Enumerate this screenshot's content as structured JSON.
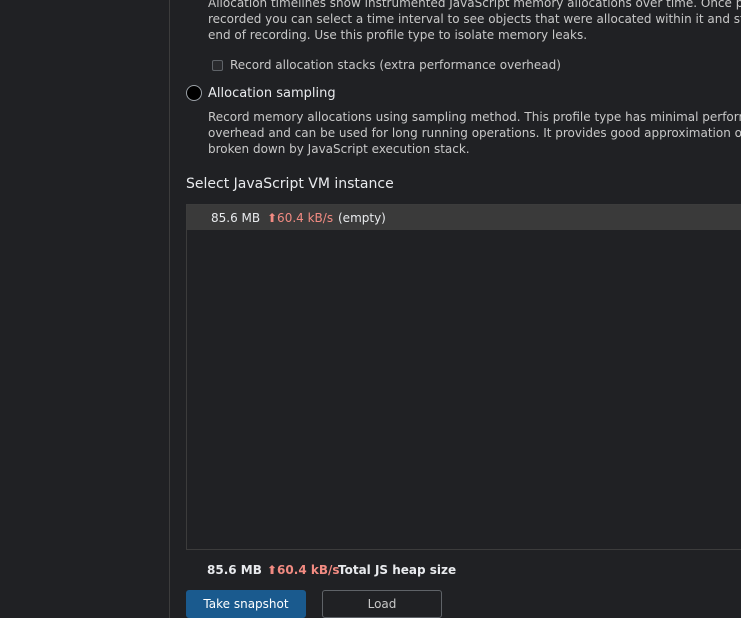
{
  "allocation_timeline": {
    "description_lines": [
      "Allocation timelines show instrumented JavaScript memory allocations over time. Once profile is",
      "recorded you can select a time interval to see objects that were allocated within it and still alive by th",
      "end of recording. Use this profile type to isolate memory leaks."
    ],
    "checkbox_label": "Record allocation stacks (extra performance overhead)"
  },
  "allocation_sampling": {
    "label": "Allocation sampling",
    "description_lines": [
      "Record memory allocations using sampling method. This profile type has minimal performance",
      "overhead and can be used for long running operations. It provides good approximation of allocations",
      "broken down by JavaScript execution stack."
    ]
  },
  "vm_section": {
    "title": "Select JavaScript VM instance",
    "instances": [
      {
        "size": "85.6 MB",
        "rate": "⬆60.4 kB/s",
        "name": "(empty)"
      }
    ]
  },
  "summary": {
    "size": "85.6 MB",
    "rate": "⬆60.4 kB/s",
    "label": "Total JS heap size"
  },
  "buttons": {
    "take_snapshot": "Take snapshot",
    "load": "Load"
  },
  "colors": {
    "background": "#202124",
    "primary_button": "#1a5a8e",
    "rate_red": "#f28b82"
  }
}
